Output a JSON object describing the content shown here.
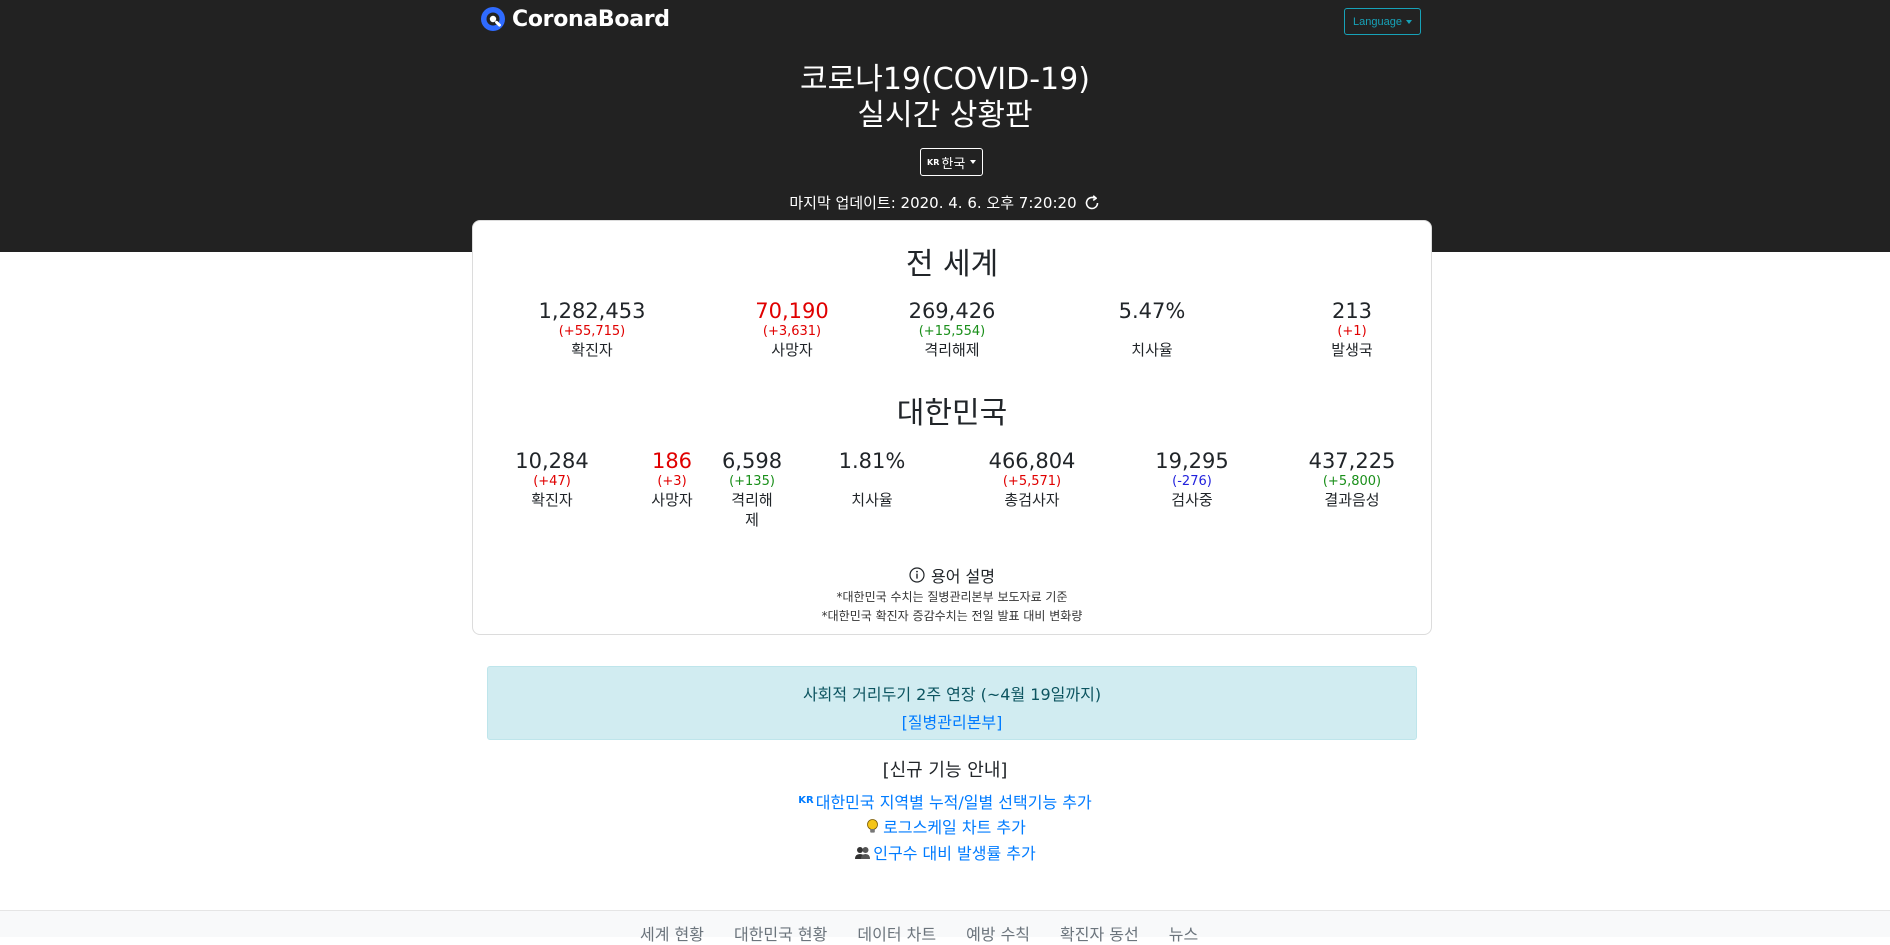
{
  "header": {
    "brand": "CoronaBoard",
    "language_button": "Language",
    "title_line1": "코로나19(COVID-19)",
    "title_line2": "실시간 상황판",
    "country_flag": "KR",
    "country_label": "한국",
    "last_updated": "마지막 업데이트: 2020. 4. 6. 오후 7:20:20"
  },
  "world": {
    "title": "전 세계",
    "stats": [
      {
        "value": "1,282,453",
        "delta": "(+55,715)",
        "label": "확진자"
      },
      {
        "value": "70,190",
        "delta": "(+3,631)",
        "label": "사망자"
      },
      {
        "value": "269,426",
        "delta": "(+15,554)",
        "label": "격리해제"
      },
      {
        "value": "5.47%",
        "delta": "",
        "label": "치사율"
      },
      {
        "value": "213",
        "delta": "(+1)",
        "label": "발생국"
      }
    ]
  },
  "korea": {
    "title": "대한민국",
    "stats": [
      {
        "value": "10,284",
        "delta": "(+47)",
        "label": "확진자"
      },
      {
        "value": "186",
        "delta": "(+3)",
        "label": "사망자"
      },
      {
        "value": "6,598",
        "delta": "(+135)",
        "label_line1": "격리해",
        "label_line2": "제"
      },
      {
        "value": "1.81%",
        "delta": "",
        "label": "치사율"
      },
      {
        "value": "466,804",
        "delta": "(+5,571)",
        "label": "총검사자"
      },
      {
        "value": "19,295",
        "delta": "(-276)",
        "label": "검사중"
      },
      {
        "value": "437,225",
        "delta": "(+5,800)",
        "label": "결과음성"
      }
    ]
  },
  "terms": {
    "label": "용어 설명",
    "note1": "*대한민국 수치는 질병관리본부 보도자료 기준",
    "note2": "*대한민국 확진자 증감수치는 전일 발표 대비 변화량"
  },
  "alert": {
    "text": "사회적 거리두기 2주 연장 (~4월 19일까지)",
    "link": "[질병관리본부]"
  },
  "new_features": {
    "title": "[신규 기능 안내]",
    "items": [
      {
        "prefix": "KR",
        "text": "대한민국 지역별 누적/일별 선택기능 추가",
        "icon": "kr-flag-icon"
      },
      {
        "text": "로그스케일 차트 추가",
        "icon": "lightbulb-icon"
      },
      {
        "text": "인구수 대비 발생률 추가",
        "icon": "people-icon"
      }
    ]
  },
  "footer": {
    "nav": [
      "세계 현황",
      "대한민국 현황",
      "데이터 차트",
      "예방 수칙",
      "확진자 동선",
      "뉴스"
    ]
  },
  "colors": {
    "header_bg": "#222222",
    "increase_red": "#e00000",
    "recovered_green": "#1a8f1a",
    "decrease_blue": "#2222dd",
    "link_blue": "#007bff",
    "alert_bg": "#d1ecf1"
  }
}
